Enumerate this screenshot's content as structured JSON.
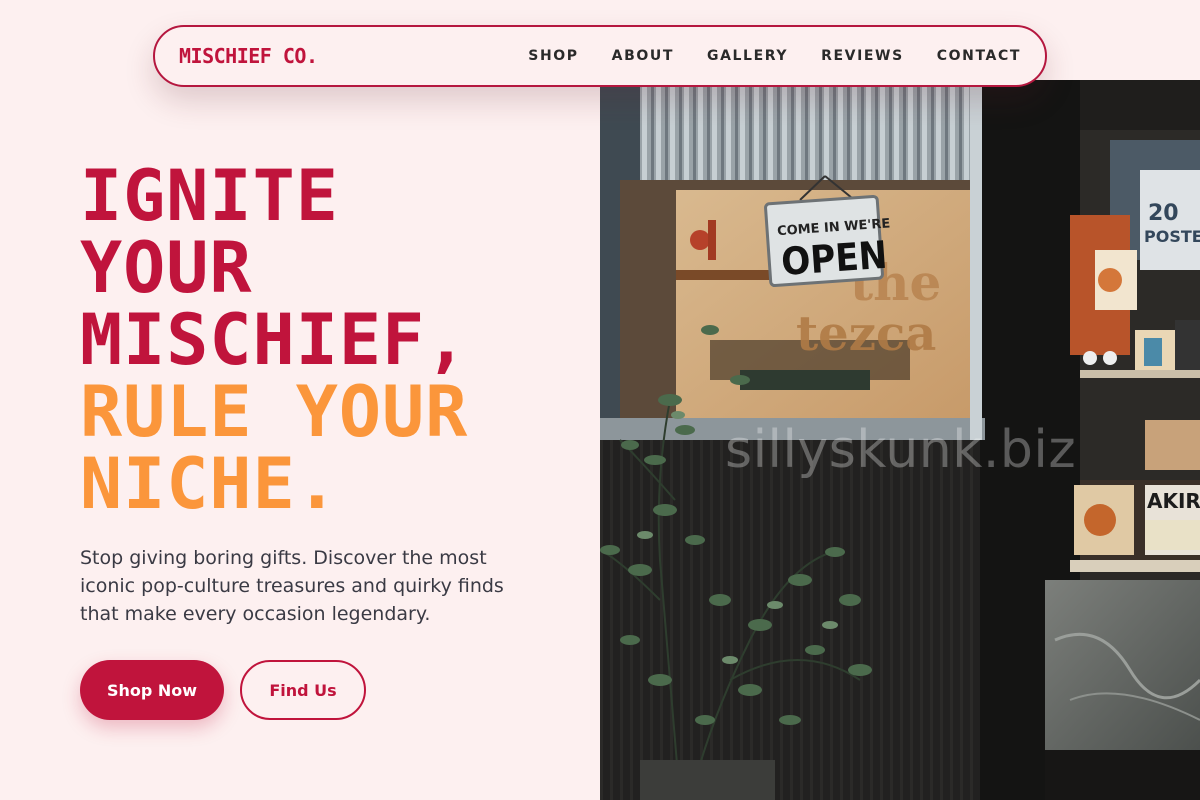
{
  "brand": {
    "name": "MISCHIEF CO."
  },
  "nav": {
    "items": [
      {
        "label": "SHOP"
      },
      {
        "label": "ABOUT"
      },
      {
        "label": "GALLERY"
      },
      {
        "label": "REVIEWS"
      },
      {
        "label": "CONTACT"
      }
    ]
  },
  "hero": {
    "title_lines_red": [
      "IGNITE",
      "YOUR",
      "MISCHIEF,"
    ],
    "title_lines_orange": [
      "RULE YOUR",
      "NICHE."
    ],
    "description": "Stop giving boring gifts. Discover the most iconic pop-culture treasures and quirky finds that make every occasion legendary.",
    "primary_button": "Shop Now",
    "secondary_button": "Find Us"
  },
  "photo": {
    "watermark": "sillyskunk.biz",
    "sign_line1": "COME IN WE'RE",
    "sign_line2": "OPEN",
    "poster_text": "AKIRA",
    "poster_top_number": "20",
    "poster_top_word": "POSTER"
  },
  "colors": {
    "accent_red": "#c0143c",
    "accent_orange": "#fb963b",
    "background": "#fdf0f0",
    "text_dark": "#3a3a44"
  }
}
